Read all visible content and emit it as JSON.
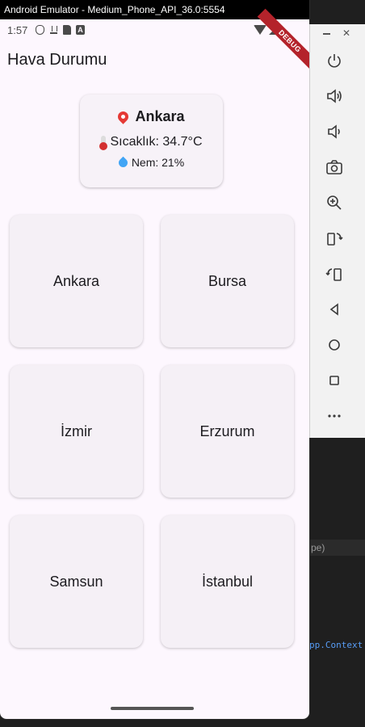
{
  "window": {
    "title": "Android Emulator - Medium_Phone_API_36.0:5554"
  },
  "status_bar": {
    "time": "1:57"
  },
  "debug_banner": "DEBUG",
  "app": {
    "title": "Hava Durumu",
    "summary": {
      "city": "Ankara",
      "temperature": "Sıcaklık: 34.7°C",
      "humidity": "Nem: 21%"
    },
    "cities": [
      "Ankara",
      "Bursa",
      "İzmir",
      "Erzurum",
      "Samsun",
      "İstanbul"
    ]
  },
  "emulator_controls": [
    "power",
    "volume-up",
    "volume-down",
    "camera",
    "zoom",
    "rotate-left",
    "rotate-right",
    "back",
    "home",
    "overview",
    "more"
  ],
  "background": {
    "strip_text": "pe)",
    "code_text": "pp.Context"
  }
}
